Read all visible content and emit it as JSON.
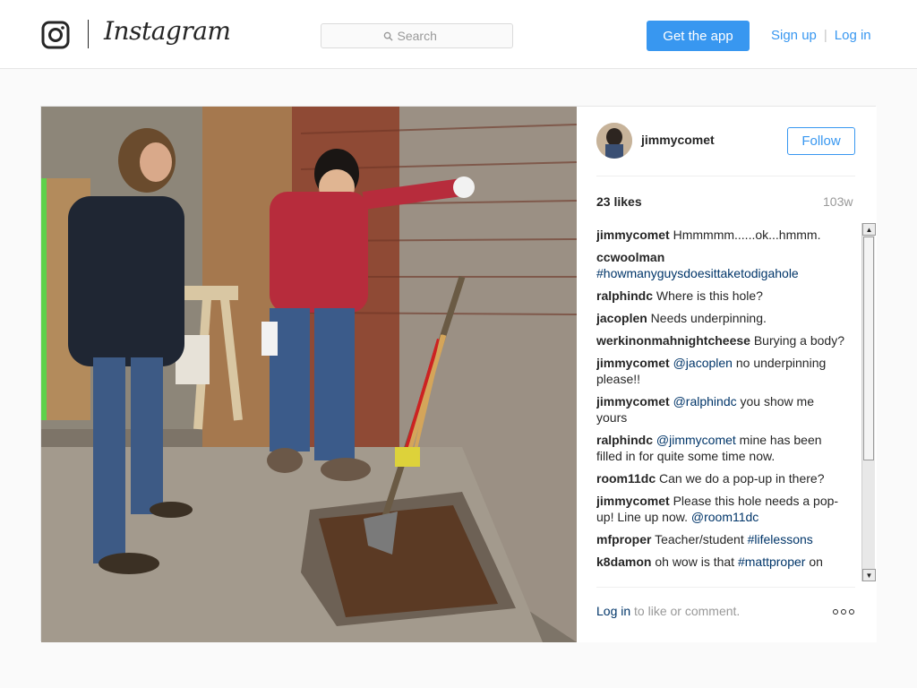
{
  "header": {
    "brand": "Instagram",
    "search_placeholder": "Search",
    "get_app": "Get the app",
    "sign_up": "Sign up",
    "separator": "|",
    "log_in": "Log in"
  },
  "post": {
    "username": "jimmycomet",
    "follow": "Follow",
    "likes": "23 likes",
    "age": "103w",
    "comments": [
      {
        "user": "jimmycomet",
        "parts": [
          {
            "t": " Hmmmmm......ok...hmmm."
          }
        ]
      },
      {
        "user": "ccwoolman",
        "parts": [
          {
            "t": " "
          },
          {
            "t": "#howmanyguysdoesittaketodigahole",
            "link": true
          }
        ]
      },
      {
        "user": "ralphindc",
        "parts": [
          {
            "t": " Where is this hole?"
          }
        ]
      },
      {
        "user": "jacoplen",
        "parts": [
          {
            "t": " Needs underpinning."
          }
        ]
      },
      {
        "user": "werkinonmahnightcheese",
        "parts": [
          {
            "t": " Burying a body?"
          }
        ]
      },
      {
        "user": "jimmycomet",
        "parts": [
          {
            "t": " "
          },
          {
            "t": "@jacoplen",
            "link": true
          },
          {
            "t": " no underpinning please!!"
          }
        ]
      },
      {
        "user": "jimmycomet",
        "parts": [
          {
            "t": " "
          },
          {
            "t": "@ralphindc",
            "link": true
          },
          {
            "t": " you show me yours"
          }
        ]
      },
      {
        "user": "ralphindc",
        "parts": [
          {
            "t": " "
          },
          {
            "t": "@jimmycomet",
            "link": true
          },
          {
            "t": " mine has been filled in for quite some time now."
          }
        ]
      },
      {
        "user": "room11dc",
        "parts": [
          {
            "t": " Can we do a pop-up in there?"
          }
        ]
      },
      {
        "user": "jimmycomet",
        "parts": [
          {
            "t": " Please this hole needs a pop-up! Line up now. "
          },
          {
            "t": "@room11dc",
            "link": true
          }
        ]
      },
      {
        "user": "mfproper",
        "parts": [
          {
            "t": " Teacher/student "
          },
          {
            "t": "#lifelessons",
            "link": true
          }
        ]
      },
      {
        "user": "k8damon",
        "parts": [
          {
            "t": " oh wow is that "
          },
          {
            "t": "#mattproper",
            "link": true
          },
          {
            "t": " on"
          }
        ]
      }
    ],
    "footer_login": "Log in",
    "footer_rest": " to like or comment."
  },
  "colors": {
    "accent": "#3897f0",
    "link": "#003569",
    "muted": "#999999",
    "text": "#262626"
  },
  "icons": {
    "logo": "instagram-camera-icon",
    "search": "search-icon",
    "more": "more-options-icon"
  }
}
